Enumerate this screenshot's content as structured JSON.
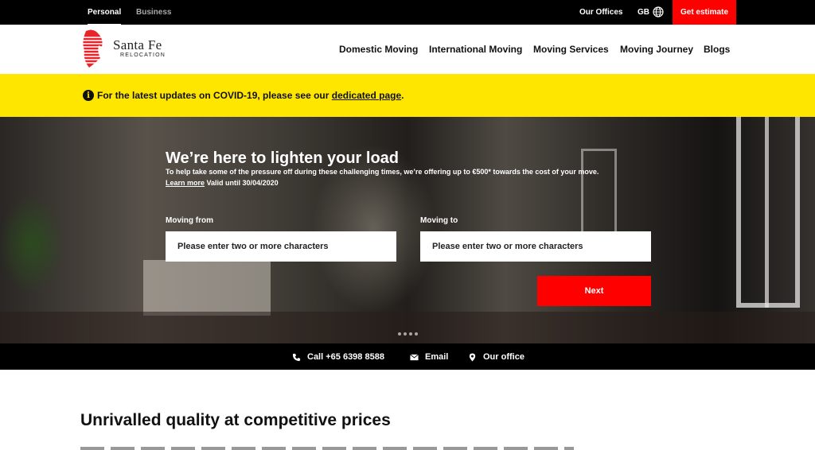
{
  "topbar": {
    "segments": [
      "Personal",
      "Business"
    ],
    "offices": "Our Offices",
    "lang": "GB",
    "cta": "Get estimate"
  },
  "header": {
    "logo_name": "Santa Fe",
    "logo_sub": "RELOCATION",
    "nav": [
      "Domestic Moving",
      "International Moving",
      "Moving Services",
      "Moving Journey",
      "Blogs"
    ]
  },
  "covid": {
    "text": "For the latest updates on COVID-19, please see our",
    "link": "dedicated page",
    "end": "."
  },
  "hero": {
    "title": "We’re here to lighten your load",
    "sub": "To help take some of the pressure off during these challenging times, we’re offering up to €500* towards the cost of your move.",
    "learn_more": "Learn more",
    "valid": "Valid until 30/04/2020",
    "from_label": "Moving from",
    "to_label": "Moving to",
    "placeholder": "Please enter two or more characters",
    "next": "Next"
  },
  "contact": {
    "call": "Call +65 6398 8588",
    "email": "Email",
    "office": "Our office"
  },
  "section": {
    "title": "Unrivalled quality at competitive prices"
  },
  "colors": {
    "brand_red": "#ff0000",
    "banner_yellow": "#ffe600",
    "bar_black": "#000000"
  }
}
